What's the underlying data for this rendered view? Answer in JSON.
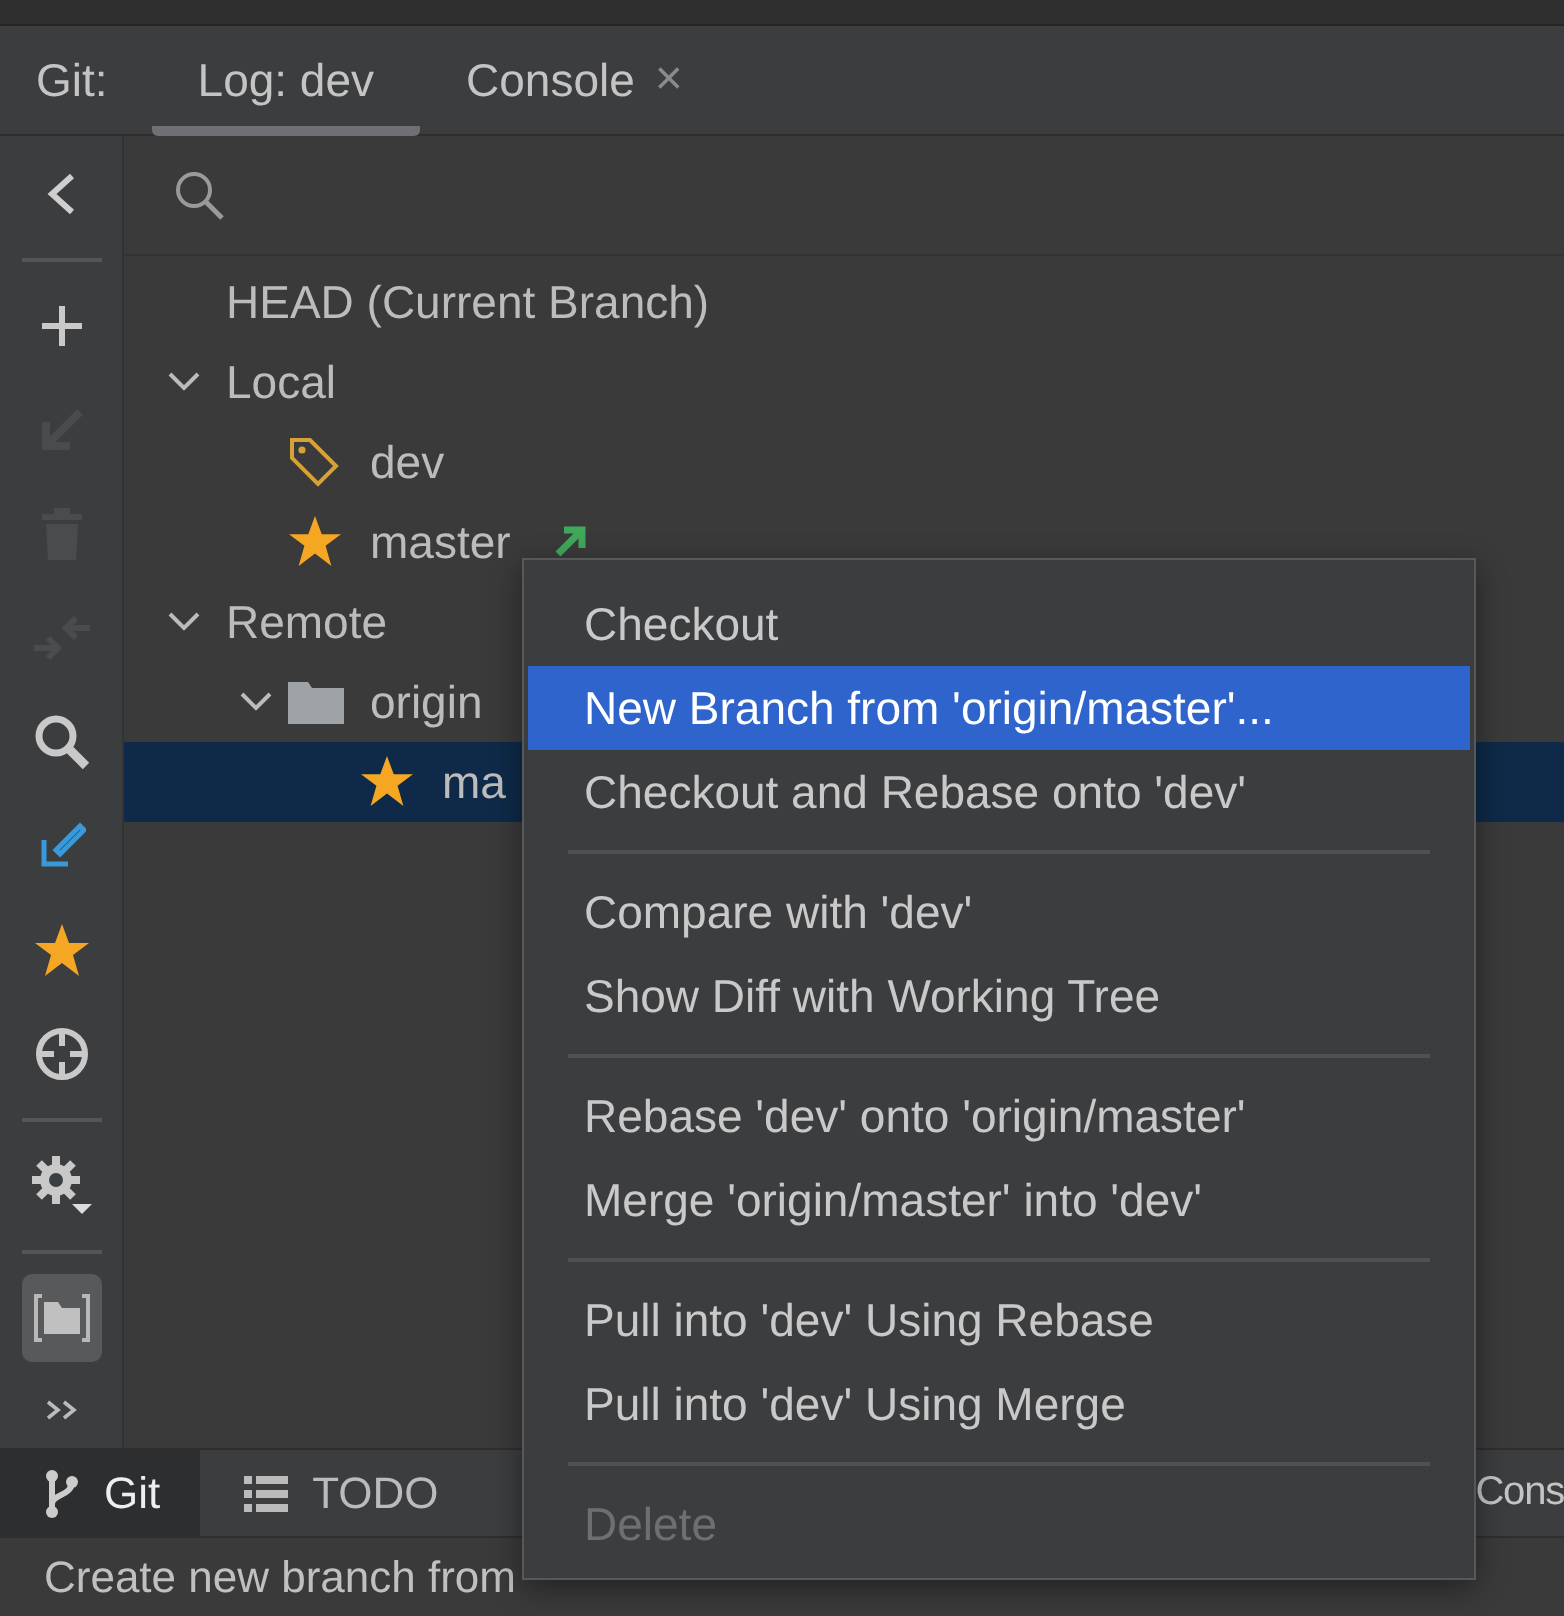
{
  "tool_window": {
    "title": "Git:",
    "tabs": [
      {
        "label": "Log: dev",
        "selected": true,
        "closable": false
      },
      {
        "label": "Console",
        "selected": false,
        "closable": true,
        "close_glyph": "×"
      }
    ]
  },
  "toolbar": {
    "items": [
      {
        "kind": "back",
        "disabled": false,
        "selected": false
      },
      {
        "kind": "separator"
      },
      {
        "kind": "add",
        "disabled": false,
        "selected": false
      },
      {
        "kind": "checkout",
        "disabled": true,
        "selected": false
      },
      {
        "kind": "delete",
        "disabled": true,
        "selected": false
      },
      {
        "kind": "compare",
        "disabled": true,
        "selected": false
      },
      {
        "kind": "search",
        "disabled": false,
        "selected": false
      },
      {
        "kind": "update",
        "disabled": false,
        "selected": false
      },
      {
        "kind": "favorite",
        "disabled": false,
        "selected": false
      },
      {
        "kind": "locate",
        "disabled": false,
        "selected": false
      },
      {
        "kind": "separator"
      },
      {
        "kind": "settings",
        "disabled": false,
        "selected": false
      },
      {
        "kind": "separator"
      },
      {
        "kind": "panel",
        "disabled": false,
        "selected": true
      },
      {
        "kind": "more",
        "disabled": false,
        "selected": false
      }
    ]
  },
  "tree": {
    "nodes": [
      {
        "label": "HEAD (Current Branch)",
        "selected": false,
        "outgoing": false
      },
      {
        "label": "Local",
        "selected": false,
        "outgoing": false,
        "expanded": true,
        "children": [
          {
            "label": "dev",
            "kind": "tag",
            "selected": false,
            "outgoing": false
          },
          {
            "label": "master",
            "kind": "star",
            "selected": false,
            "outgoing": true
          }
        ]
      },
      {
        "label": "Remote",
        "selected": false,
        "outgoing": false,
        "expanded": true,
        "children": [
          {
            "label": "origin",
            "kind": "folder",
            "selected": false,
            "outgoing": false,
            "expanded": true,
            "children": [
              {
                "label": "ma",
                "kind": "star",
                "selected": true,
                "outgoing": false
              }
            ]
          }
        ]
      }
    ]
  },
  "context_menu": {
    "groups": [
      [
        {
          "label": "Checkout",
          "selected": false,
          "disabled": false
        },
        {
          "label": "New Branch from 'origin/master'...",
          "selected": true,
          "disabled": false
        },
        {
          "label": "Checkout and Rebase onto 'dev'",
          "selected": false,
          "disabled": false
        }
      ],
      [
        {
          "label": "Compare with 'dev'",
          "selected": false,
          "disabled": false
        },
        {
          "label": "Show Diff with Working Tree",
          "selected": false,
          "disabled": false
        }
      ],
      [
        {
          "label": "Rebase 'dev' onto 'origin/master'",
          "selected": false,
          "disabled": false
        },
        {
          "label": "Merge 'origin/master' into 'dev'",
          "selected": false,
          "disabled": false
        }
      ],
      [
        {
          "label": "Pull into 'dev' Using Rebase",
          "selected": false,
          "disabled": false
        },
        {
          "label": "Pull into 'dev' Using Merge",
          "selected": false,
          "disabled": false
        }
      ],
      [
        {
          "label": "Delete",
          "selected": false,
          "disabled": true
        }
      ]
    ]
  },
  "bottom_bar": {
    "tabs": [
      {
        "label": "Git",
        "kind": "branch",
        "selected": true
      },
      {
        "label": "TODO",
        "kind": "list",
        "selected": false
      },
      {
        "label": "Cons",
        "selected": false
      }
    ]
  },
  "status_bar": {
    "text": "Create new branch from"
  }
}
